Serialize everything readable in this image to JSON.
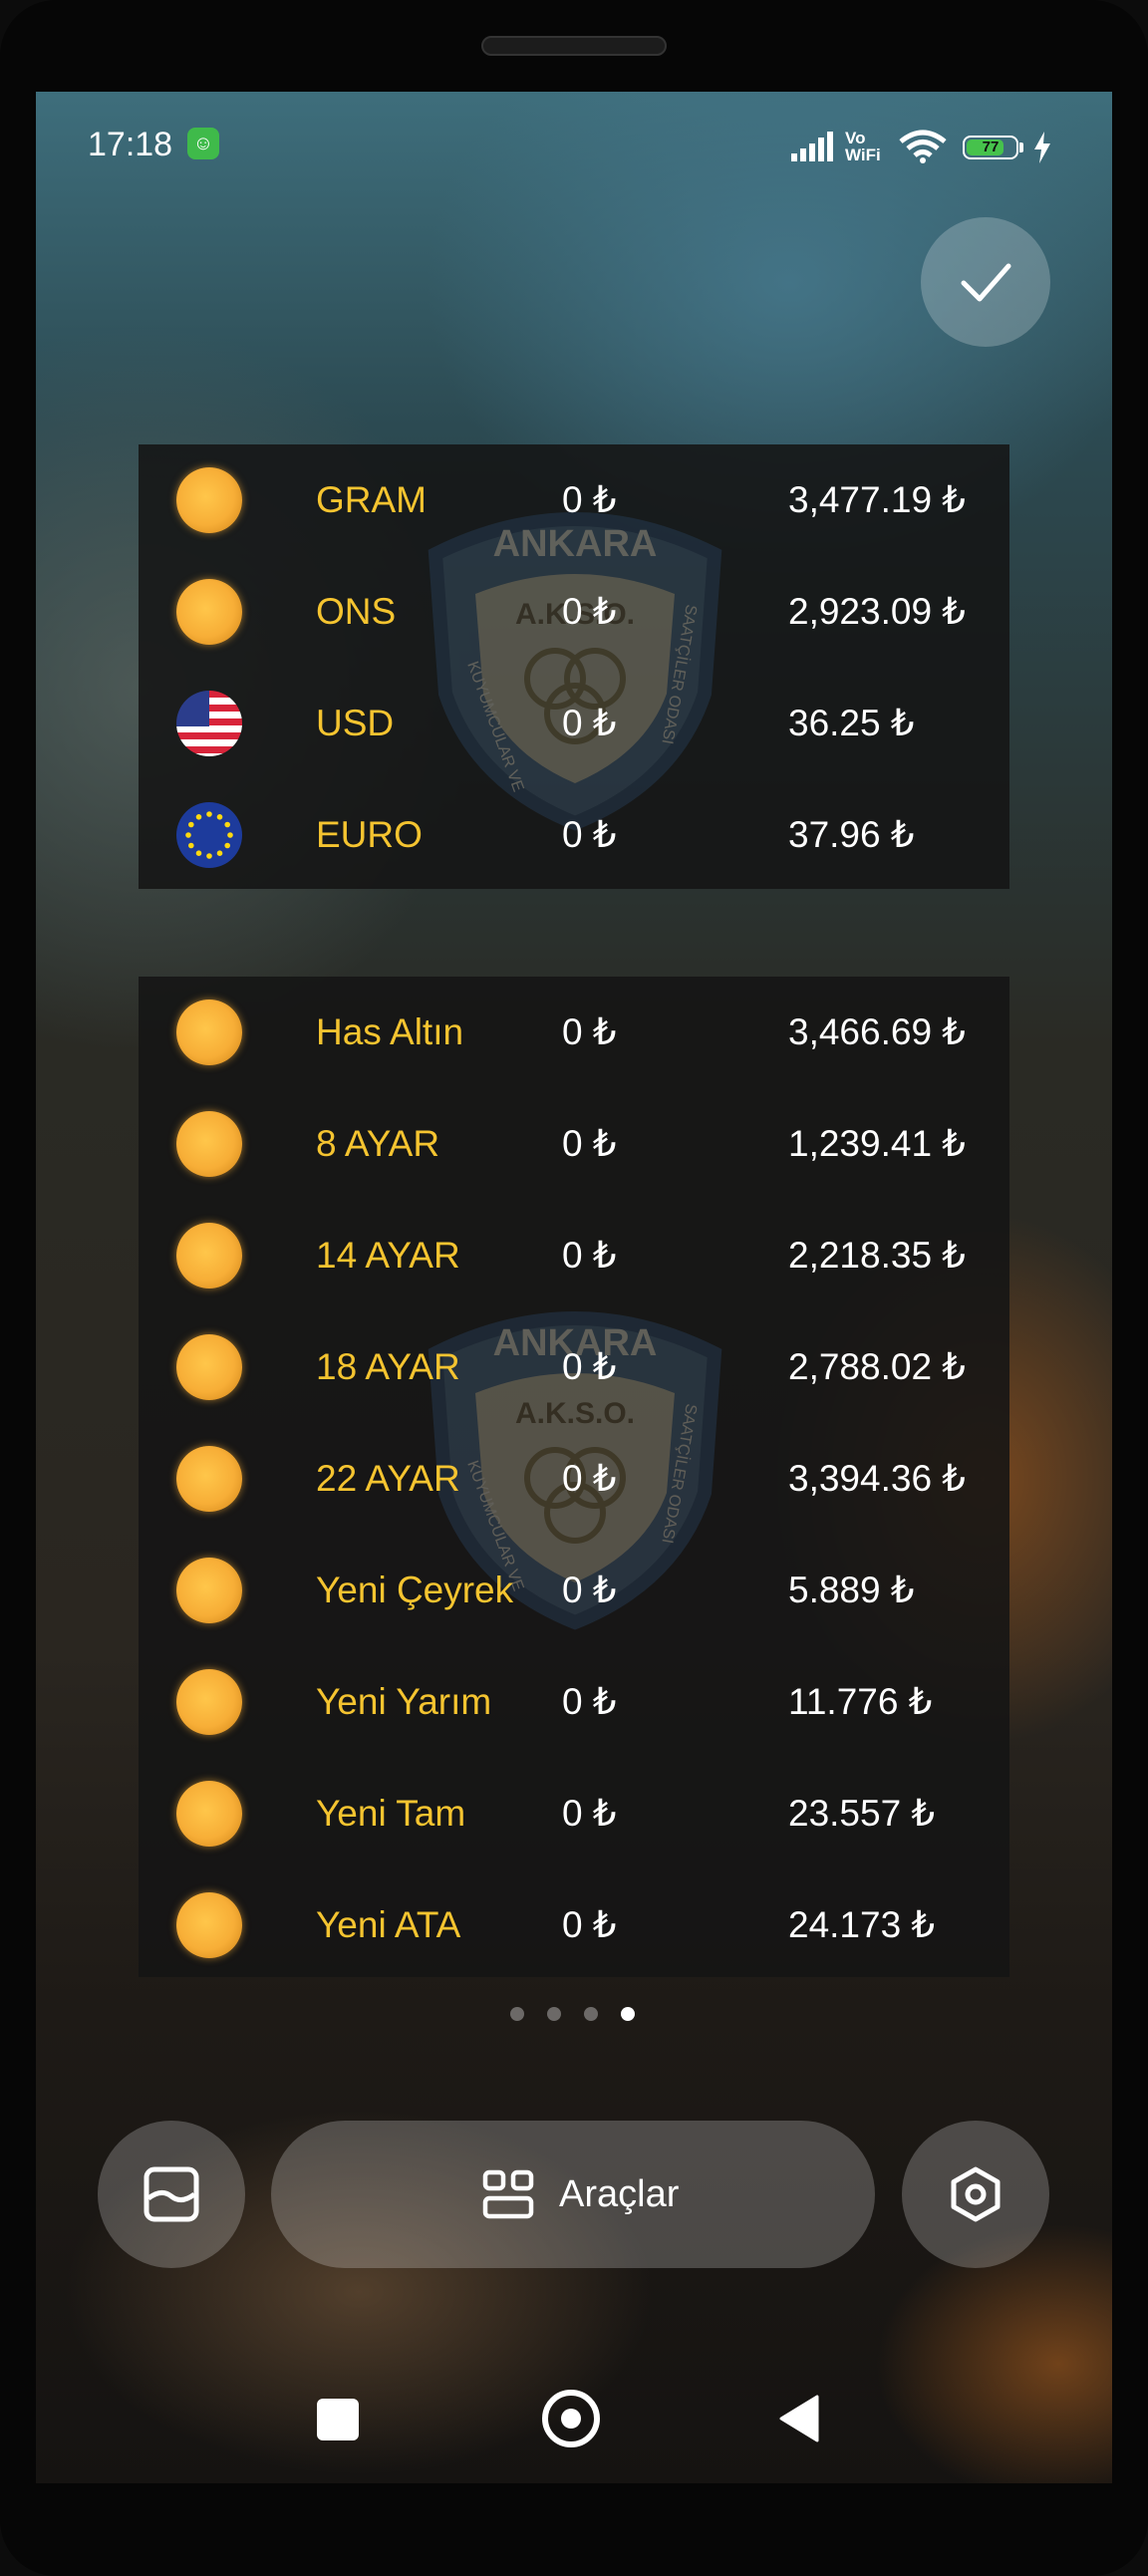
{
  "status_bar": {
    "time": "17:18",
    "network_label_top": "Vo",
    "network_label_bottom": "WiFi",
    "battery": "77",
    "battery_level": 0.77
  },
  "icons": {
    "confirm": "check-icon",
    "wallpaper": "wallpaper-icon",
    "tools": "grid-icon",
    "settings": "hexagon-settings-icon",
    "nav_recents": "square-icon",
    "nav_home": "circle-icon",
    "nav_back": "triangle-back-icon"
  },
  "colors": {
    "name_text": "#f5c430",
    "value_text": "#ffffff",
    "coin": "#f7ae37",
    "widget_bg": "#141414"
  },
  "top_widget": {
    "rows": [
      {
        "icon": "coin",
        "name": "GRAM",
        "buy": "0 ₺",
        "sell": "3,477.19 ₺"
      },
      {
        "icon": "coin",
        "name": "ONS",
        "buy": "0 ₺",
        "sell": "2,923.09 ₺"
      },
      {
        "icon": "flag-usd",
        "name": "USD",
        "buy": "0 ₺",
        "sell": "36.25 ₺"
      },
      {
        "icon": "flag-eur",
        "name": "EURO",
        "buy": "0 ₺",
        "sell": "37.96 ₺"
      }
    ]
  },
  "bottom_widget": {
    "rows": [
      {
        "icon": "coin",
        "name": "Has Altın",
        "buy": "0 ₺",
        "sell": "3,466.69 ₺"
      },
      {
        "icon": "coin",
        "name": "8 AYAR",
        "buy": "0 ₺",
        "sell": "1,239.41 ₺"
      },
      {
        "icon": "coin",
        "name": "14 AYAR",
        "buy": "0 ₺",
        "sell": "2,218.35 ₺"
      },
      {
        "icon": "coin",
        "name": "18 AYAR",
        "buy": "0 ₺",
        "sell": "2,788.02 ₺"
      },
      {
        "icon": "coin",
        "name": "22 AYAR",
        "buy": "0 ₺",
        "sell": "3,394.36 ₺"
      },
      {
        "icon": "coin",
        "name": "Yeni Çeyrek",
        "buy": "0 ₺",
        "sell": "5.889 ₺"
      },
      {
        "icon": "coin",
        "name": "Yeni Yarım",
        "buy": "0 ₺",
        "sell": "11.776 ₺"
      },
      {
        "icon": "coin",
        "name": "Yeni Tam",
        "buy": "0 ₺",
        "sell": "23.557 ₺"
      },
      {
        "icon": "coin",
        "name": "Yeni ATA",
        "buy": "0 ₺",
        "sell": "24.173 ₺"
      }
    ]
  },
  "watermark": {
    "top_text": "ANKARA",
    "middle_text": "A.K.S.O.",
    "ring_text_left": "KUYUMCULAR VE",
    "ring_text_right": "SAATÇİLER ODASI"
  },
  "page_indicator": {
    "count": 4,
    "active": 4
  },
  "bottom_actions": {
    "tools_label": "Araçlar"
  }
}
